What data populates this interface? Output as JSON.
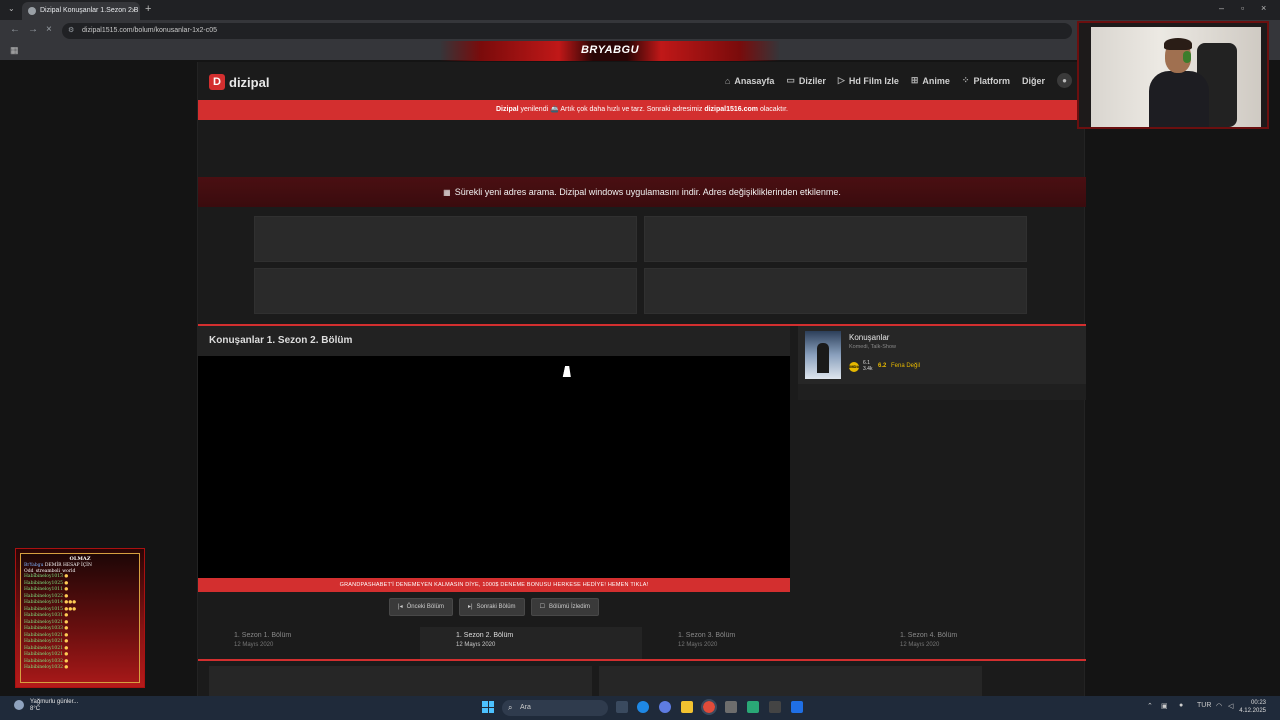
{
  "browser": {
    "tab_title": "Dizipal Konuşanlar 1.Sezon 2.B",
    "url": "dizipal1515.com/bolum/konusanlar-1x2-c05"
  },
  "stream": {
    "streamer_name": "BRYABGU"
  },
  "site": {
    "logo_letter": "D",
    "logo_text": "dizipal",
    "nav": [
      {
        "label": "Anasayfa",
        "icon": "home-icon"
      },
      {
        "label": "Diziler",
        "icon": "tv-icon"
      },
      {
        "label": "Hd Film Izle",
        "icon": "film-icon"
      },
      {
        "label": "Anime",
        "icon": "anime-icon"
      },
      {
        "label": "Platform",
        "icon": "grid-icon"
      },
      {
        "label": "Diğer",
        "icon": ""
      }
    ],
    "notice": {
      "brand": "Dizipal",
      "text": " yenilendi 🚢 Artık çok daha hızlı ve tarz. Sonraki adresimiz ",
      "next_domain": "dizipal1516.com",
      "suffix": " olacaktır."
    },
    "windows_ad": "Sürekli yeni adres arama. Dizipal windows uygulamasını indir. Adres değişikliklerinden etkilenme."
  },
  "episode": {
    "title": "Konuşanlar 1. Sezon 2. Bölüm",
    "promo": "GRANDPASHABET'İ DENEMEYEN KALMASIN DİYE, 1000$ DENEME BONUSU HERKESE HEDİYE! HEMEN TIKLA!",
    "controls": {
      "prev": "Önceki Bölüm",
      "next": "Sonraki Bölüm",
      "watched": "Bölümü İzledim"
    },
    "list": [
      {
        "label": "1. Sezon 1. Bölüm",
        "date": "12 Mayıs 2020",
        "active": false
      },
      {
        "label": "1. Sezon 2. Bölüm",
        "date": "12 Mayıs 2020",
        "active": true
      },
      {
        "label": "1. Sezon 3. Bölüm",
        "date": "12 Mayıs 2020",
        "active": false
      },
      {
        "label": "1. Sezon 4. Bölüm",
        "date": "12 Mayıs 2020",
        "active": false
      }
    ]
  },
  "show": {
    "name": "Konuşanlar",
    "genres": "Komedi, Talk-Show",
    "imdb_badge": "IMDb",
    "rating_small": "6.1",
    "rating_small_sub": "3.4k",
    "rating": "6.2",
    "rating_label": "Fena Değil"
  },
  "chat": {
    "header": "OLMAZ",
    "header2_user": "BrYabgu",
    "header2_text": "DEMİR HESAP İÇİN",
    "header3": "Odd_streamboli_world",
    "rows": [
      "Habibineloy1013",
      "Habibineloy1025",
      "Habibineloy1011",
      "Habibineloy1022",
      "Habibineloy1014",
      "Habibineloy1015",
      "Habibineloy1031",
      "Habibineloy1021",
      "Habibineloy1033",
      "Habibineloy1021",
      "Habibineloy1021",
      "Habibineloy1021",
      "Habibineloy1021",
      "Habibineloy1032",
      "Habibineloy1032"
    ]
  },
  "taskbar": {
    "weather": "Yağmurlu günler...",
    "temp": "8°C",
    "search_placeholder": "Ara",
    "lang": "TUR",
    "time": "00:23",
    "date": "4.12.2025"
  },
  "colors": {
    "accent": "#d32f2f",
    "page_bg": "#1b1b1b",
    "rating": "#e6b800"
  }
}
